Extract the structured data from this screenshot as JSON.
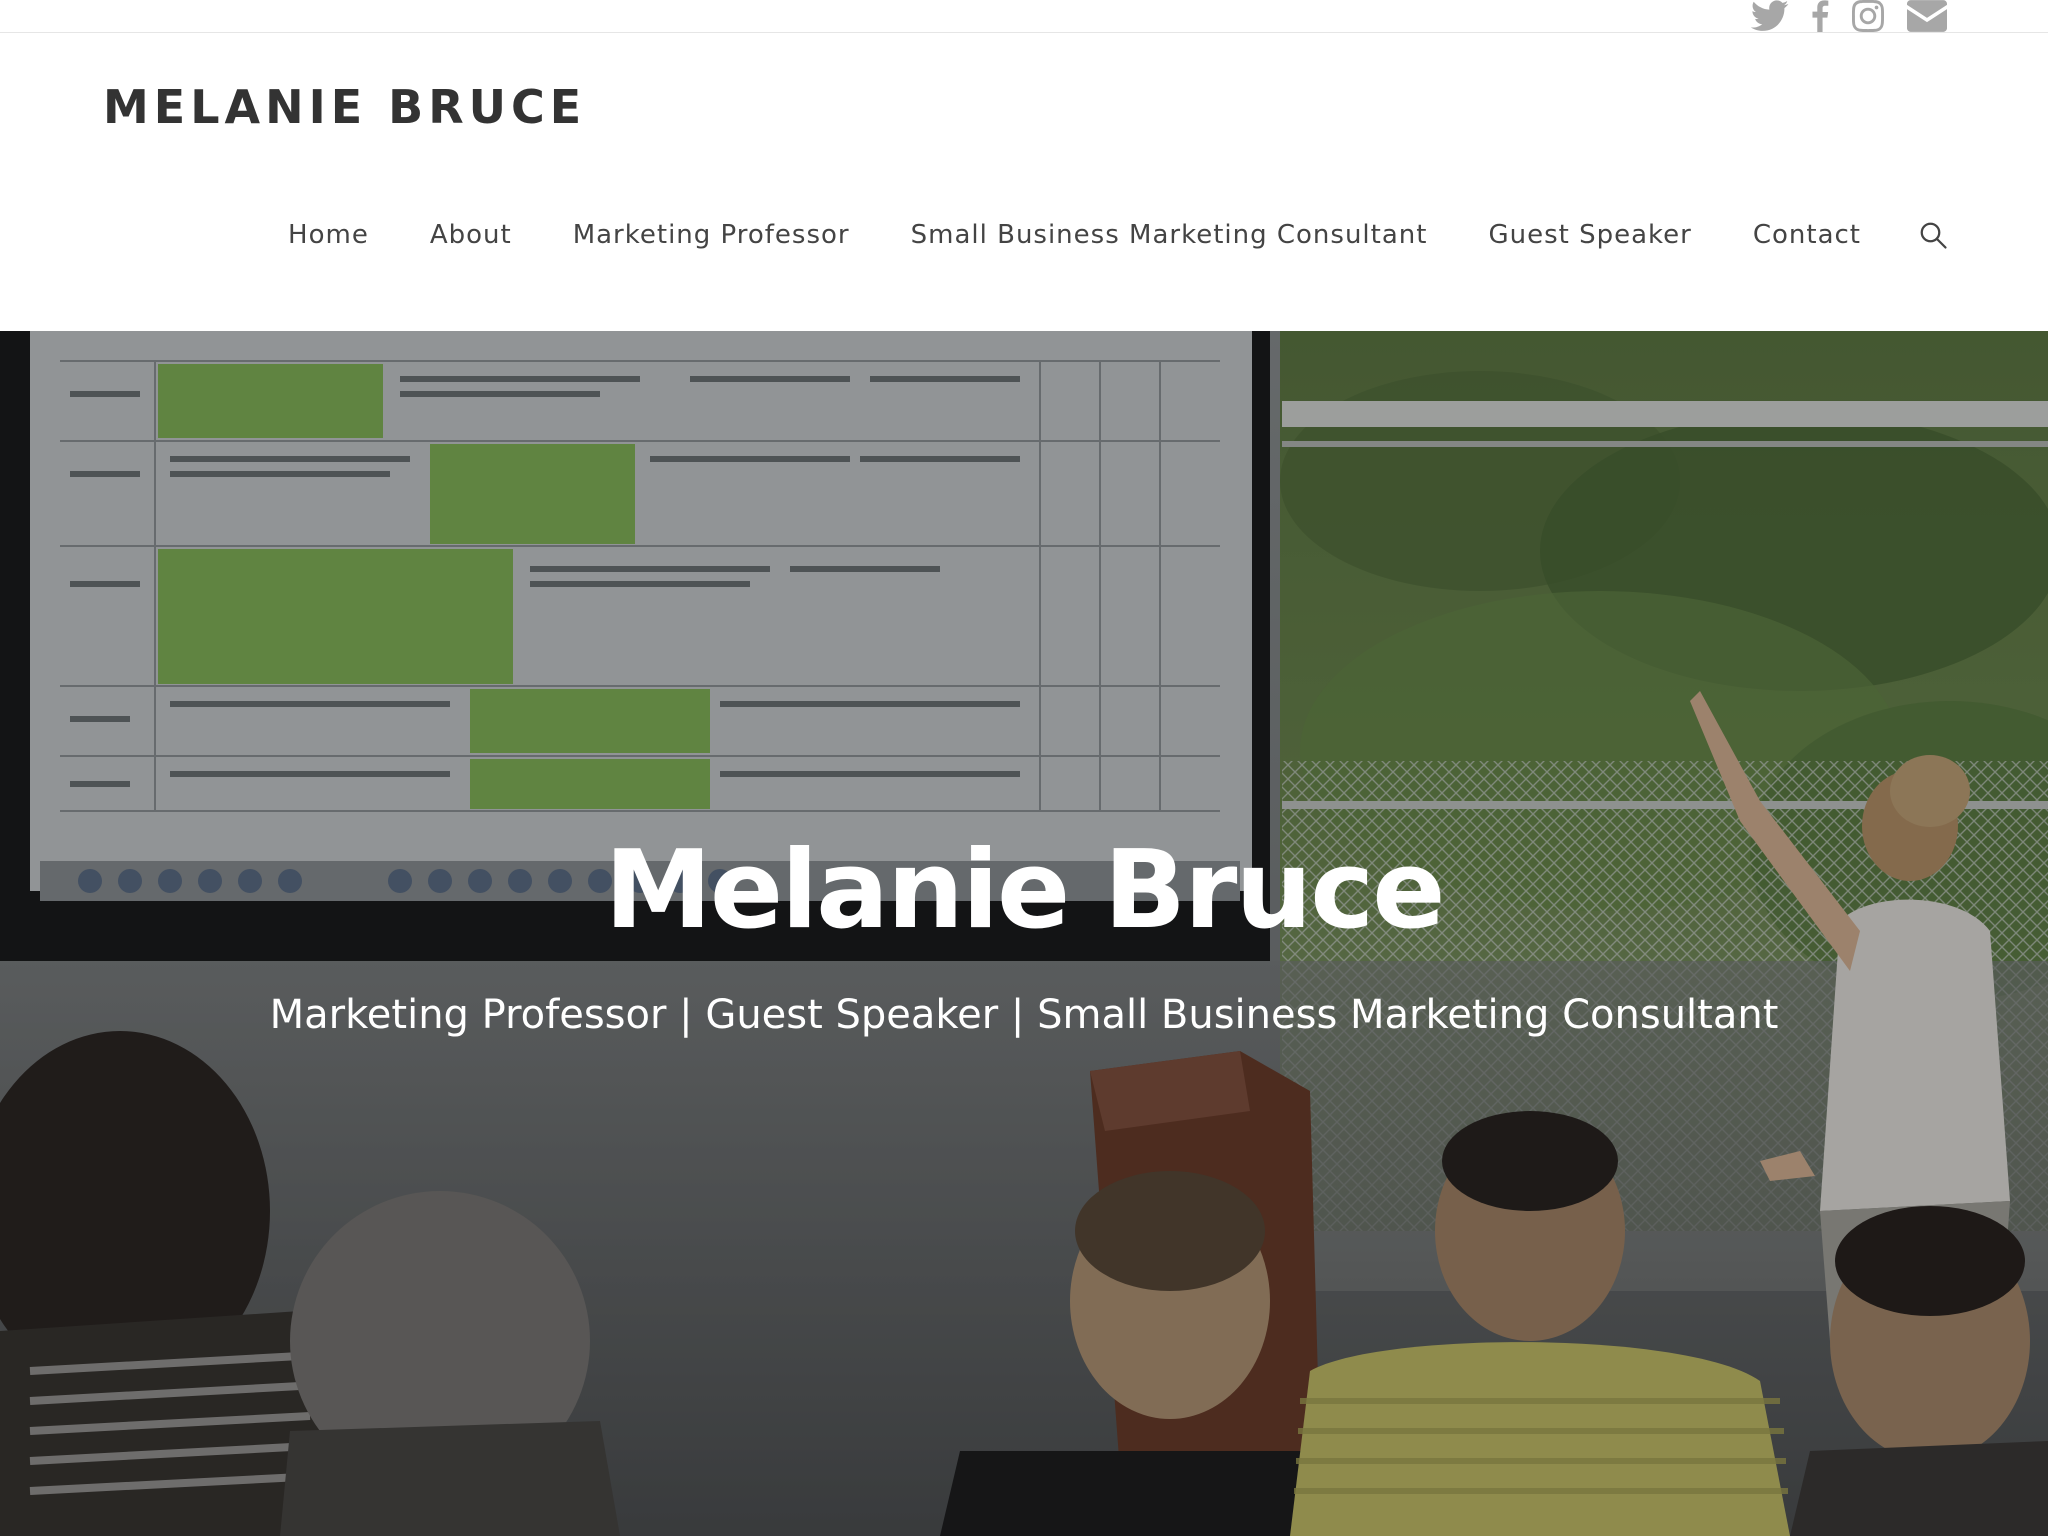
{
  "social": [
    {
      "name": "twitter",
      "icon": "twitter-icon"
    },
    {
      "name": "facebook",
      "icon": "facebook-icon"
    },
    {
      "name": "instagram",
      "icon": "instagram-icon"
    },
    {
      "name": "email",
      "icon": "envelope-icon"
    }
  ],
  "header": {
    "logo": "MELANIE BRUCE"
  },
  "nav": {
    "items": [
      {
        "label": "Home"
      },
      {
        "label": "About"
      },
      {
        "label": "Marketing Professor"
      },
      {
        "label": "Small Business Marketing Consultant"
      },
      {
        "label": "Guest Speaker"
      },
      {
        "label": "Contact"
      }
    ],
    "search_icon": "search-icon"
  },
  "hero": {
    "title": "Melanie Bruce",
    "subtitle": "Marketing Professor | Guest Speaker | Small Business Marketing Consultant"
  },
  "colors": {
    "text_dark": "#333333",
    "nav_text": "#444444",
    "social_icon": "#a7a7a7",
    "hero_text": "#ffffff"
  }
}
